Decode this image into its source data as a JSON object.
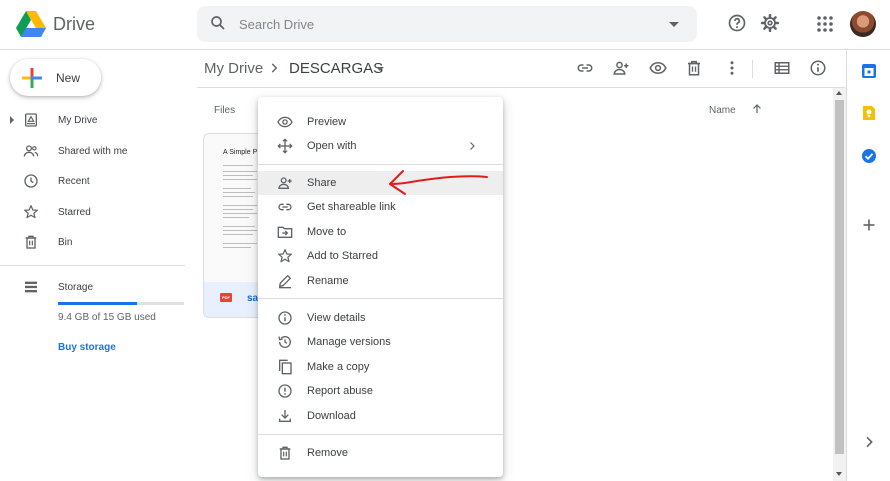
{
  "app": {
    "name": "Drive"
  },
  "search": {
    "placeholder": "Search Drive"
  },
  "sidebar": {
    "new_label": "New",
    "items": [
      {
        "label": "My Drive",
        "icon": "my-drive-icon"
      },
      {
        "label": "Shared with me",
        "icon": "shared-icon"
      },
      {
        "label": "Recent",
        "icon": "clock-icon"
      },
      {
        "label": "Starred",
        "icon": "star-icon"
      },
      {
        "label": "Bin",
        "icon": "trash-icon"
      }
    ],
    "storage": {
      "label": "Storage",
      "usage_text": "9.4 GB of 15 GB used",
      "used_fraction": 0.627,
      "buy_label": "Buy storage"
    }
  },
  "breadcrumb": {
    "root": "My Drive",
    "current": "DESCARGAS"
  },
  "main": {
    "files_label": "Files",
    "sort_label": "Name",
    "file": {
      "title": "A Simple P",
      "name": "sa",
      "type_badge": "PDF"
    }
  },
  "context_menu": {
    "items": [
      {
        "label": "Preview",
        "icon": "eye-icon"
      },
      {
        "label": "Open with",
        "icon": "move-icon",
        "submenu": true
      },
      {
        "label": "Share",
        "icon": "add-person-icon",
        "highlighted": true
      },
      {
        "label": "Get shareable link",
        "icon": "link-icon"
      },
      {
        "label": "Move to",
        "icon": "folder-move-icon"
      },
      {
        "label": "Add to Starred",
        "icon": "star-icon"
      },
      {
        "label": "Rename",
        "icon": "pencil-icon"
      },
      {
        "label": "View details",
        "icon": "info-icon"
      },
      {
        "label": "Manage versions",
        "icon": "history-icon"
      },
      {
        "label": "Make a copy",
        "icon": "copy-icon"
      },
      {
        "label": "Report abuse",
        "icon": "alert-icon"
      },
      {
        "label": "Download",
        "icon": "download-icon"
      },
      {
        "label": "Remove",
        "icon": "trash-icon"
      }
    ]
  },
  "colors": {
    "accent": "#1a73e8",
    "text": "#3c4043",
    "annotation": "#e31b1b",
    "menu_highlight": "#eeeeee"
  }
}
